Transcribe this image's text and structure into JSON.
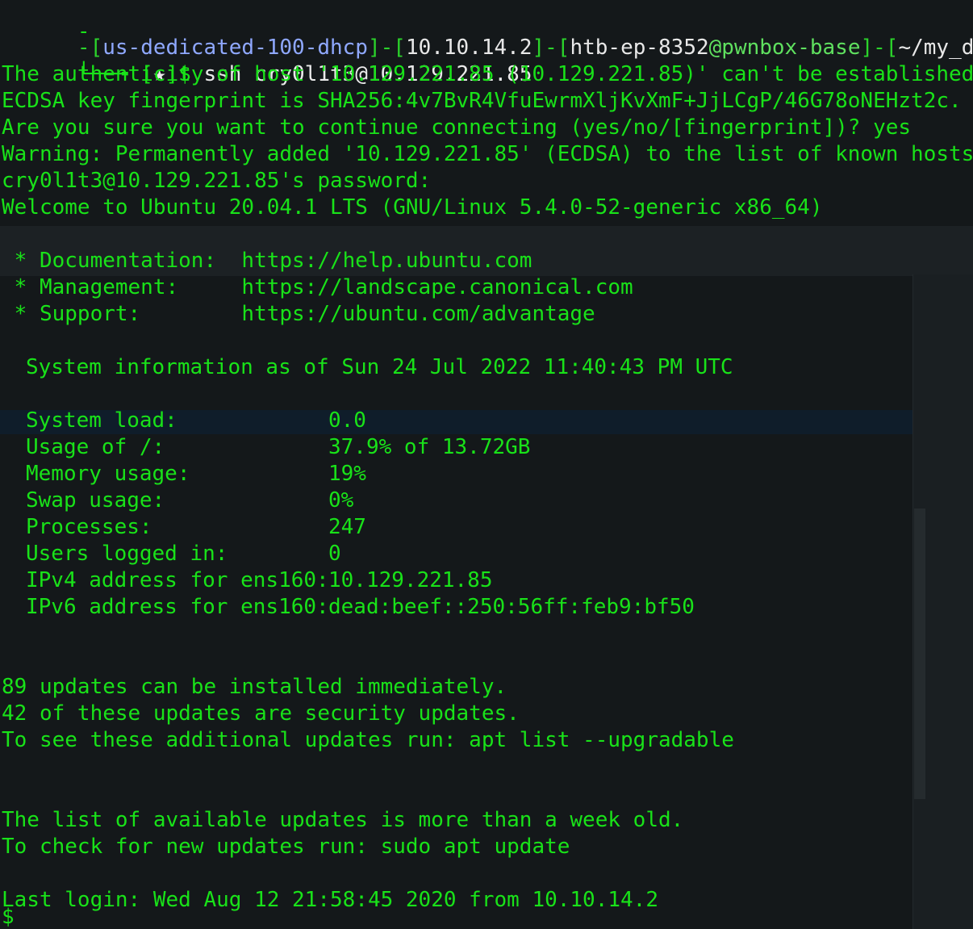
{
  "terminal": {
    "lines": {
      "partial_top": "-",
      "prompt_parts": {
        "a": "-[",
        "b": "us-dedicated-100-dhcp",
        "c": "]-[",
        "d": "10.10.14.2",
        "e": "]-[",
        "f": "htb-ep-8352",
        "g": "@pwnbox-base",
        "h": "]-[",
        "i": "~/my_data/Acader"
      },
      "prompt2_prefix": "└──╼ [",
      "prompt2_star": "★",
      "prompt2_suffix": "]$ ",
      "command": "ssh cry0l1t3@10.129.221.85",
      "auth_1": "The authenticity of host '10.129.221.85 (10.129.221.85)' can't be established.",
      "auth_2": "ECDSA key fingerprint is SHA256:4v7BvR4VfuEwrmXljKvXmF+JjLCgP/46G78oNEHzt2c.",
      "auth_3": "Are you sure you want to continue connecting (yes/no/[fingerprint])? yes",
      "auth_4": "Warning: Permanently added '10.129.221.85' (ECDSA) to the list of known hosts.",
      "auth_5": "cry0l1t3@10.129.221.85's password: ",
      "welcome": "Welcome to Ubuntu 20.04.1 LTS (GNU/Linux 5.4.0-52-generic x86_64)",
      "doc": " * Documentation:  https://help.ubuntu.com",
      "mgmt": " * Management:     https://landscape.canonical.com",
      "support": " * Support:        https://ubuntu.com/advantage",
      "sysinfo": "System information as of Sun 24 Jul 2022 11:40:43 PM UTC",
      "stats": [
        {
          "label": "System load:",
          "value": "0.0"
        },
        {
          "label": "Usage of /:",
          "value": "37.9% of 13.72GB"
        },
        {
          "label": "Memory usage:",
          "value": "19%"
        },
        {
          "label": "Swap usage:",
          "value": "0%"
        },
        {
          "label": "Processes:",
          "value": "247"
        },
        {
          "label": "Users logged in:",
          "value": "0"
        },
        {
          "label": "IPv4 address for ens160:",
          "value": "10.129.221.85"
        },
        {
          "label": "IPv6 address for ens160:",
          "value": "dead:beef::250:56ff:feb9:bf50"
        }
      ],
      "updates_1": "89 updates can be installed immediately.",
      "updates_2": "42 of these updates are security updates.",
      "updates_3": "To see these additional updates run: apt list --upgradable",
      "list_1": "The list of available updates is more than a week old.",
      "list_2": "To check for new updates run: sudo apt update",
      "last_login": "Last login: Wed Aug 12 21:58:45 2020 from 10.10.14.2",
      "final_prompt": "$"
    },
    "colors": {
      "text": "#19e219",
      "prompt_host": "#eaeaea",
      "background": "#14181a"
    }
  }
}
